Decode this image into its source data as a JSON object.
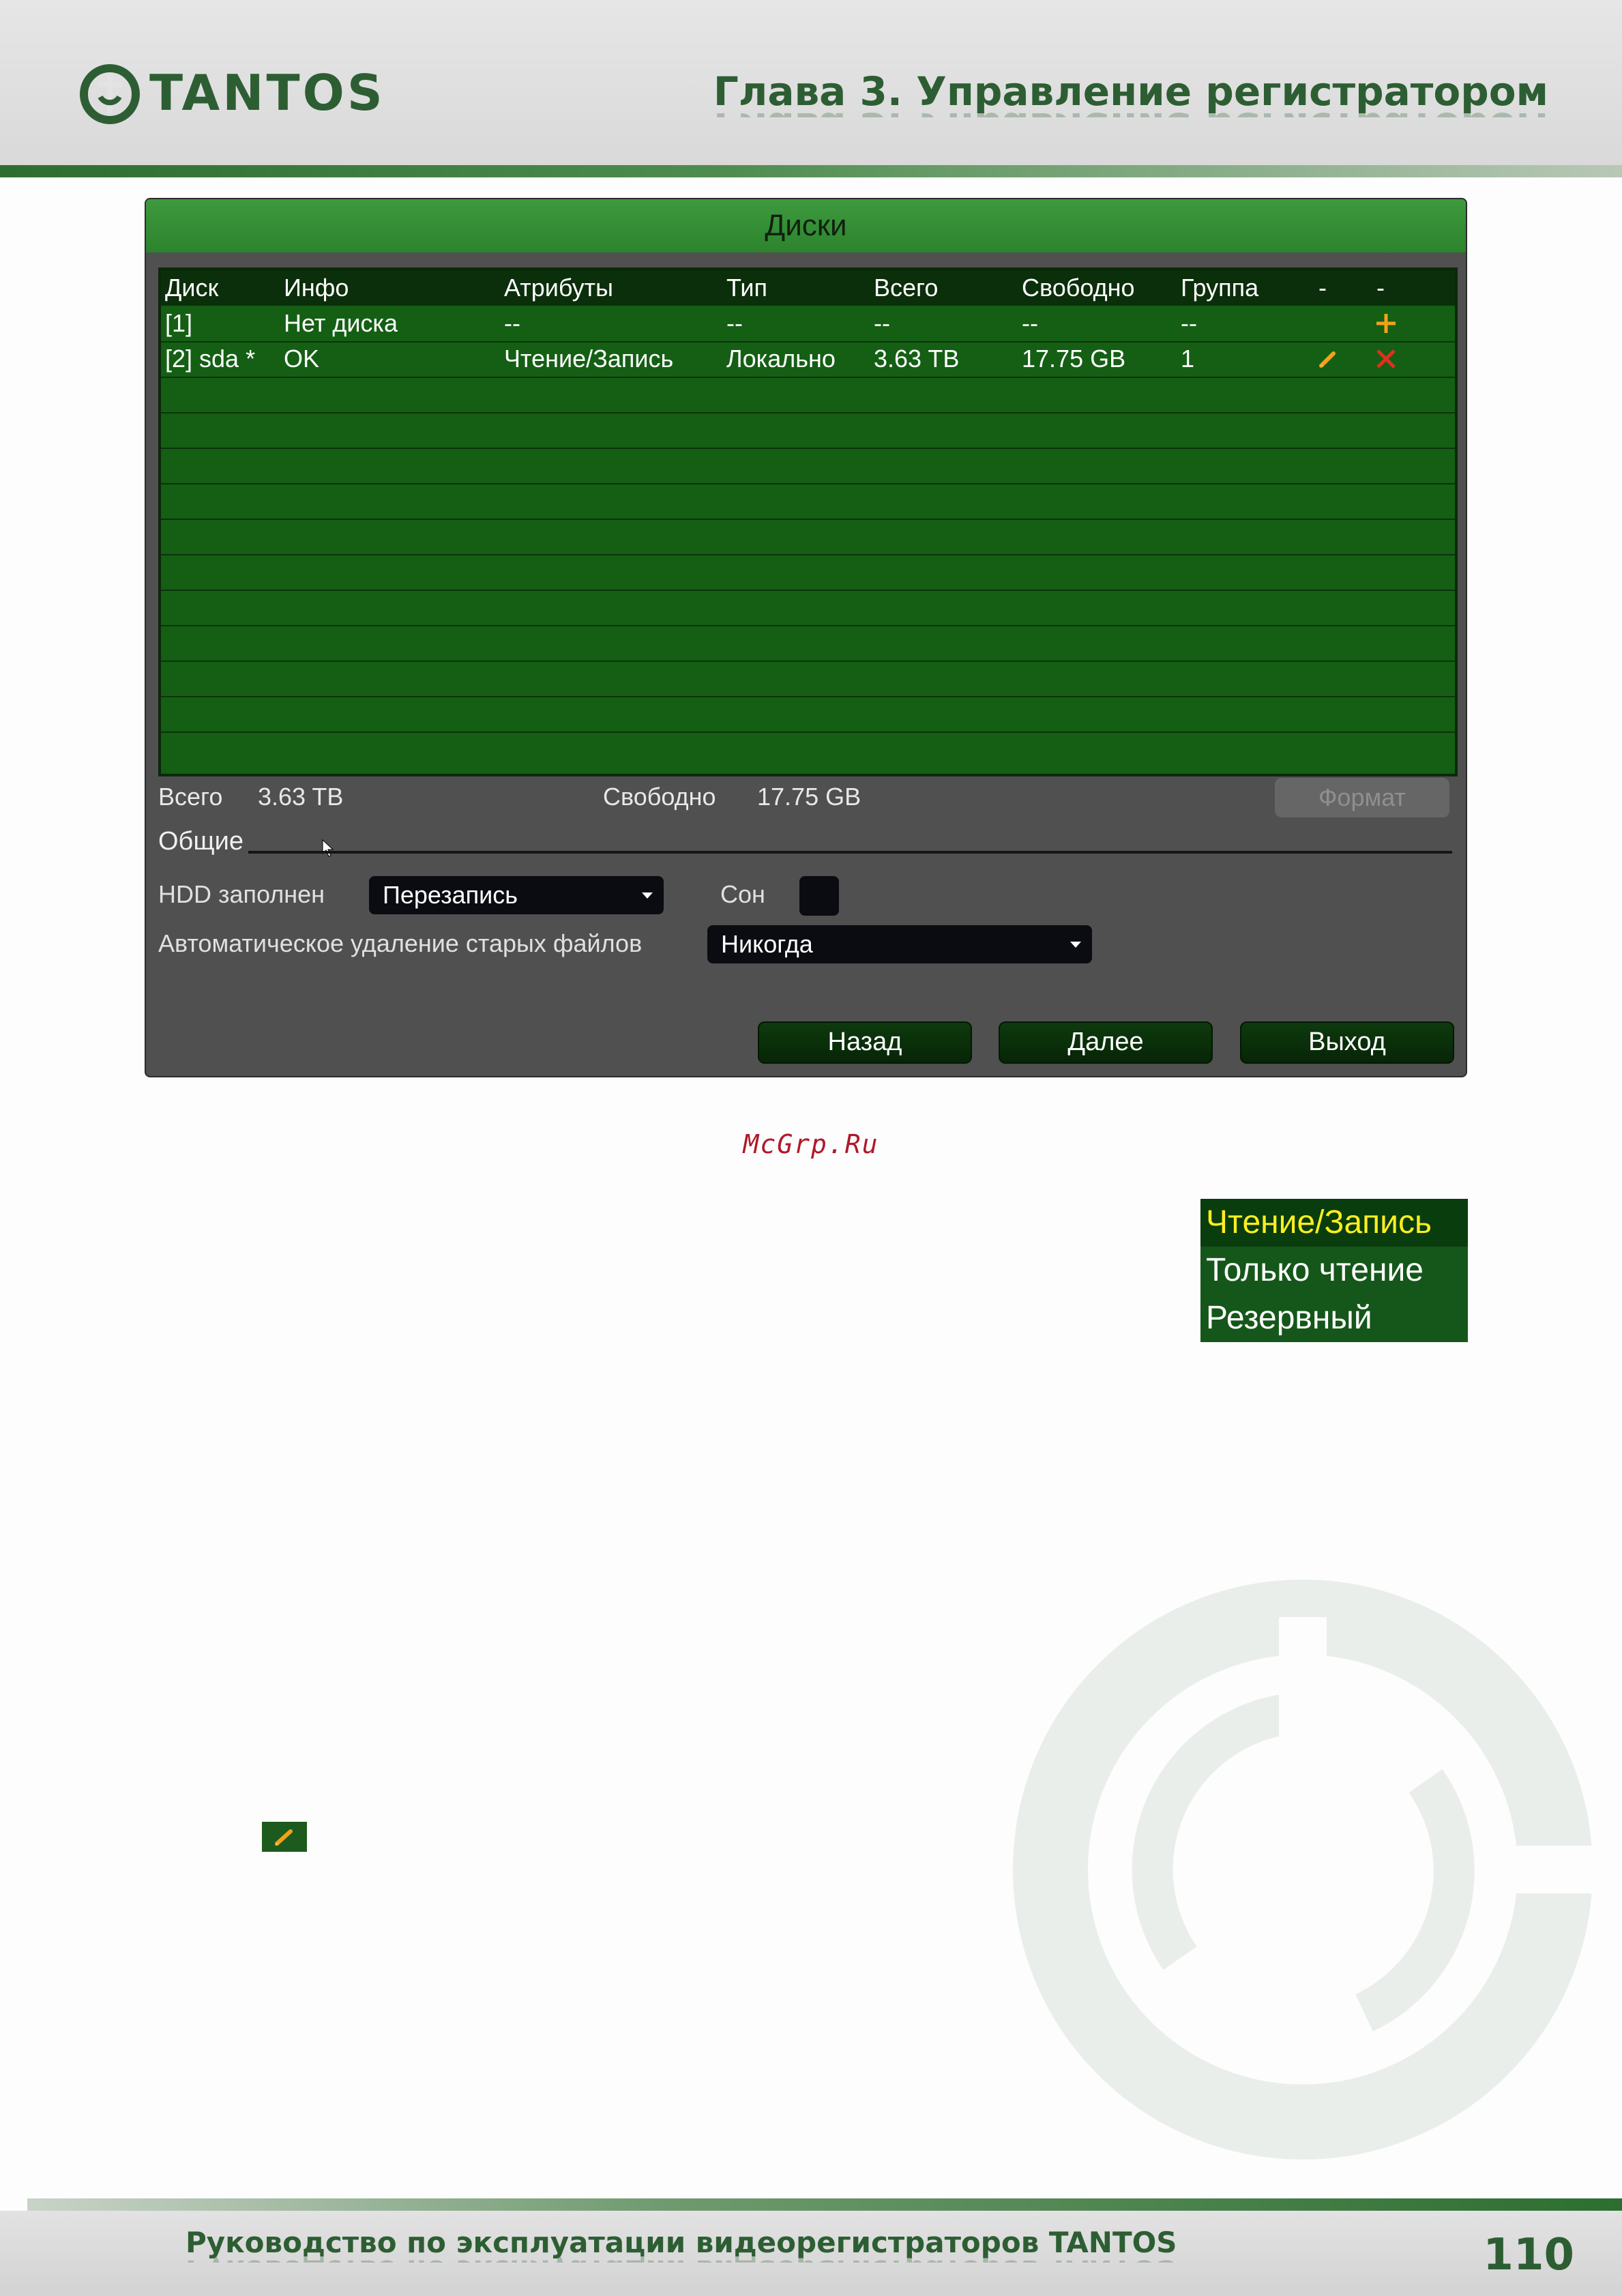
{
  "header": {
    "logo_text": "TANTOS",
    "chapter_title": "Глава 3. Управление регистратором"
  },
  "dialog": {
    "title": "Диски",
    "columns": [
      "Диск",
      "Инфо",
      "Атрибуты",
      "Тип",
      "Всего",
      "Свободно",
      "Группа",
      "-",
      "-"
    ],
    "rows": [
      {
        "disk": "[1]",
        "info": "Нет диска",
        "attributes": "--",
        "type": "--",
        "total": "--",
        "free": "--",
        "group": "--",
        "actions": [
          "add-icon"
        ]
      },
      {
        "disk": "[2] sda *",
        "info": "OK",
        "attributes": "Чтение/Запись",
        "type": "Локально",
        "total": "3.63 TB",
        "free": "17.75 GB",
        "group": "1",
        "actions": [
          "edit-icon",
          "delete-icon"
        ]
      }
    ],
    "summary": {
      "total_label": "Всего",
      "total_value": "3.63 TB",
      "free_label": "Свободно",
      "free_value": "17.75 GB"
    },
    "format_button": "Формат",
    "general_section": "Общие",
    "hdd_full_label": "HDD заполнен",
    "hdd_full_value": "Перезапись",
    "sleep_label": "Сон",
    "auto_delete_label": "Автоматическое удаление старых файлов",
    "auto_delete_value": "Никогда",
    "buttons": {
      "back": "Назад",
      "next": "Далее",
      "exit": "Выход"
    }
  },
  "watermark": "McGrp.Ru",
  "attribute_menu": {
    "items": [
      "Чтение/Запись",
      "Только чтение",
      "Резервный"
    ],
    "selected": 0
  },
  "colors": {
    "brand_green": "#2d5e33",
    "dialog_green": "#145f14",
    "highlight_yellow": "#ffee22",
    "add_icon": "#f0a21a",
    "delete_icon": "#e0301e"
  },
  "footer": {
    "text": "Руководство по эксплуатации видеорегистраторов TANTOS",
    "page_number": "110"
  }
}
